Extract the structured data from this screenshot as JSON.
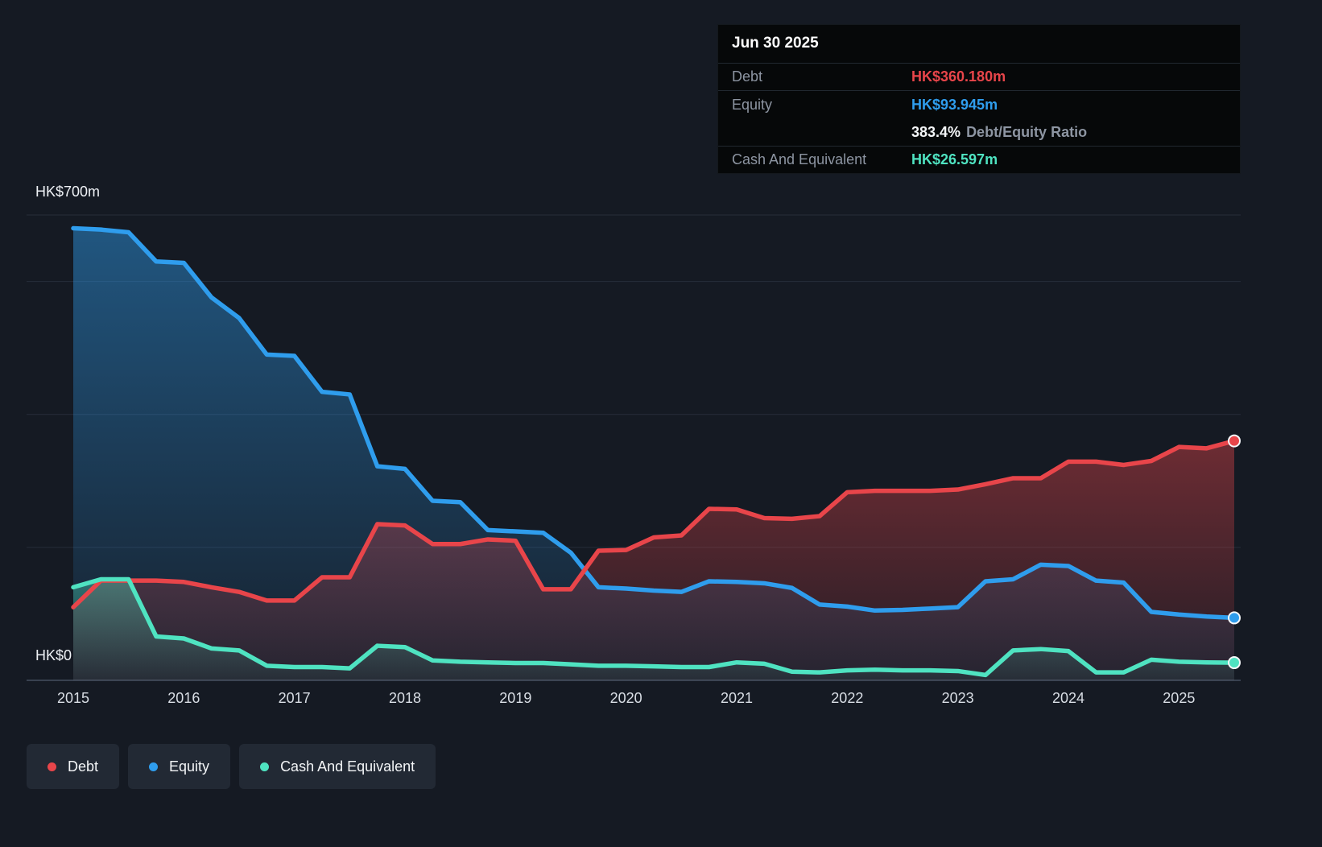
{
  "colors": {
    "debt": "#e8454a",
    "equity": "#2f9ded",
    "cash": "#4fe3c1",
    "background": "#151a23",
    "grid": "#262d3a",
    "axis_line": "#454e5e",
    "tooltip_bg": "#060809",
    "tooltip_label": "#8d95a2",
    "legend_bg": "#222934"
  },
  "tooltip": {
    "title": "Jun 30 2025",
    "debt_label": "Debt",
    "debt_value": "HK$360.180m",
    "equity_label": "Equity",
    "equity_value": "HK$93.945m",
    "ratio_value": "383.4%",
    "ratio_label": "Debt/Equity Ratio",
    "cash_label": "Cash And Equivalent",
    "cash_value": "HK$26.597m"
  },
  "legend": {
    "items": [
      {
        "label": "Debt",
        "color_key": "debt"
      },
      {
        "label": "Equity",
        "color_key": "equity"
      },
      {
        "label": "Cash And Equivalent",
        "color_key": "cash"
      }
    ]
  },
  "chart_data": {
    "type": "area",
    "unit": "HK$ millions",
    "xlim": [
      2015,
      2025.5
    ],
    "ylim": [
      0,
      700
    ],
    "y_gridlines": [
      0,
      200,
      400,
      600,
      700
    ],
    "y_top_label": "HK$700m",
    "y_bottom_label": "HK$0",
    "x_ticks": [
      2015,
      2016,
      2017,
      2018,
      2019,
      2020,
      2021,
      2022,
      2023,
      2024,
      2025
    ],
    "x_tick_labels": [
      "2015",
      "2016",
      "2017",
      "2018",
      "2019",
      "2020",
      "2021",
      "2022",
      "2023",
      "2024",
      "2025"
    ],
    "legend_position": "bottom",
    "x": [
      2015,
      2015.25,
      2015.5,
      2015.75,
      2016,
      2016.25,
      2016.5,
      2016.75,
      2017,
      2017.25,
      2017.5,
      2017.75,
      2018,
      2018.25,
      2018.5,
      2018.75,
      2019,
      2019.25,
      2019.5,
      2019.75,
      2020,
      2020.25,
      2020.5,
      2020.75,
      2021,
      2021.25,
      2021.5,
      2021.75,
      2022,
      2022.25,
      2022.5,
      2022.75,
      2023,
      2023.25,
      2023.5,
      2023.75,
      2024,
      2024.25,
      2024.5,
      2024.75,
      2025,
      2025.25,
      2025.5
    ],
    "series": [
      {
        "name": "Debt",
        "color_key": "debt",
        "values": [
          110,
          150,
          150,
          150,
          148,
          140,
          133,
          120,
          120,
          155,
          155,
          235,
          233,
          205,
          205,
          212,
          210,
          137,
          137,
          195,
          196,
          215,
          218,
          258,
          257,
          244,
          243,
          247,
          283,
          285,
          285,
          285,
          287,
          295,
          304,
          304,
          329,
          329,
          324,
          330,
          351,
          349,
          360.18
        ]
      },
      {
        "name": "Equity",
        "color_key": "equity",
        "values": [
          680,
          678,
          674,
          630,
          628,
          576,
          545,
          490,
          488,
          434,
          430,
          322,
          318,
          270,
          268,
          226,
          224,
          222,
          192,
          140,
          138,
          135,
          133,
          149,
          148,
          146,
          139,
          114,
          111,
          105,
          106,
          108,
          110,
          149,
          152,
          174,
          172,
          150,
          147,
          103,
          99,
          96,
          93.945
        ]
      },
      {
        "name": "Cash And Equivalent",
        "color_key": "cash",
        "values": [
          140,
          152,
          152,
          66,
          63,
          48,
          45,
          22,
          20,
          20,
          18,
          52,
          50,
          30,
          28,
          27,
          26,
          26,
          24,
          22,
          22,
          21,
          20,
          20,
          27,
          25,
          13,
          12,
          15,
          16,
          15,
          15,
          14,
          8,
          45,
          47,
          44,
          12,
          12,
          31,
          28,
          27,
          26.597
        ]
      }
    ]
  }
}
